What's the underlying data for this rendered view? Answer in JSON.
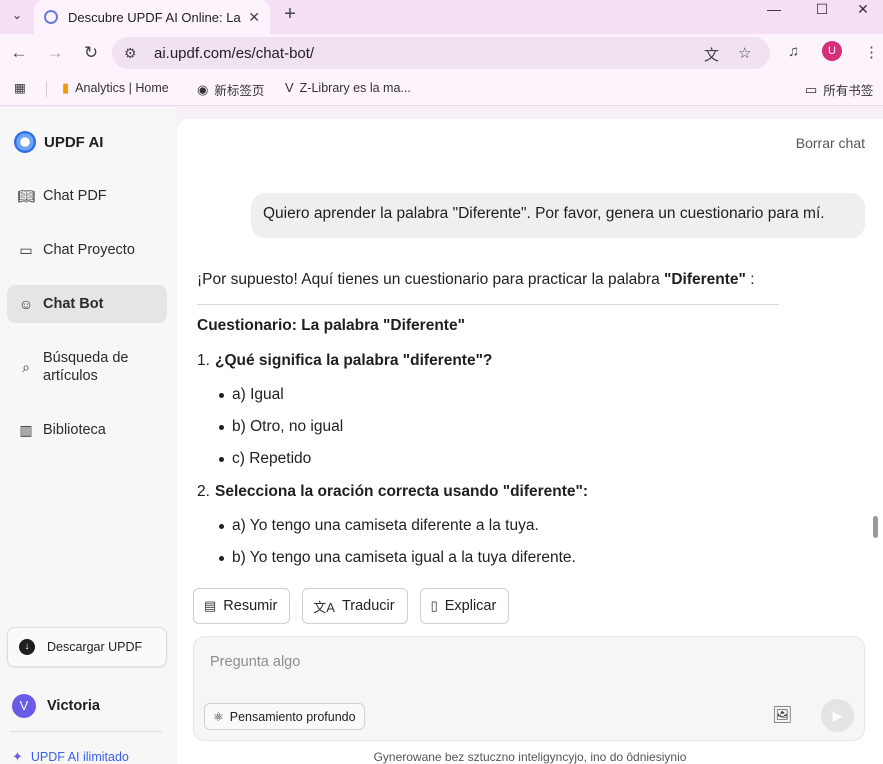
{
  "browser": {
    "tab_menu_icon": "chevron-down-icon",
    "tab_title": "Descubre UPDF AI Online: La",
    "tab_close": "✕",
    "new_tab": "+",
    "window_controls": [
      "—",
      "☐",
      "✕"
    ],
    "url": "ai.updf.com/es/chat-bot/",
    "avatar_letter": "U",
    "avatar_color": "#d62e77",
    "bookmarks": [
      {
        "label": "Analytics | Home",
        "icon": "bar-chart-icon"
      },
      {
        "label": "新标签页",
        "icon": "globe-icon"
      },
      {
        "label": "Z-Library es la ma...",
        "icon": "zlibrary-icon"
      }
    ],
    "all_bookmarks": "所有书签"
  },
  "sidebar": {
    "brand": "UPDF AI",
    "items": [
      {
        "label": "Chat PDF",
        "icon": "book-open-icon"
      },
      {
        "label": "Chat Proyecto",
        "icon": "folder-plus-icon"
      },
      {
        "label": "Chat Bot",
        "icon": "bot-icon",
        "active": true
      },
      {
        "label": "Búsqueda de artículos",
        "icon": "doc-search-icon"
      },
      {
        "label": "Biblioteca",
        "icon": "library-icon"
      }
    ],
    "download_label": "Descargar UPDF",
    "user_initial": "V",
    "user_name": "Victoria",
    "unlimited_label": "UPDF AI ilimitado",
    "accent": "#3a5fe8"
  },
  "chat": {
    "clear_label": "Borrar chat",
    "user_message": "Quiero aprender la palabra \"Diferente\". Por favor, genera un cuestionario para mí.",
    "answer_intro_pre": "¡Por supuesto! Aquí tienes un cuestionario para practicar la palabra ",
    "answer_intro_bold": "\"Diferente\"",
    "answer_intro_post": " :",
    "quiz_title": "Cuestionario: La palabra \"Diferente\"",
    "questions": [
      {
        "number": "1.",
        "text": "¿Qué significa la palabra \"diferente\"?",
        "options": [
          "a) Igual",
          "b) Otro, no igual",
          "c) Repetido"
        ]
      },
      {
        "number": "2.",
        "text": "Selecciona la oración correcta usando \"diferente\":",
        "options": [
          "a) Yo tengo una camiseta diferente a la tuya.",
          "b) Yo tengo una camiseta igual a la tuya diferente."
        ]
      }
    ]
  },
  "actions": [
    {
      "label": "Resumir",
      "icon": "summary-icon"
    },
    {
      "label": "Traducir",
      "icon": "translate-icon"
    },
    {
      "label": "Explicar",
      "icon": "explain-icon"
    }
  ],
  "composer": {
    "placeholder": "Pregunta algo",
    "deep_label": "Pensamiento profundo",
    "footer": "Gynerowane bez sztuczno inteligyncyjo, ino do ôdniesiynio"
  }
}
